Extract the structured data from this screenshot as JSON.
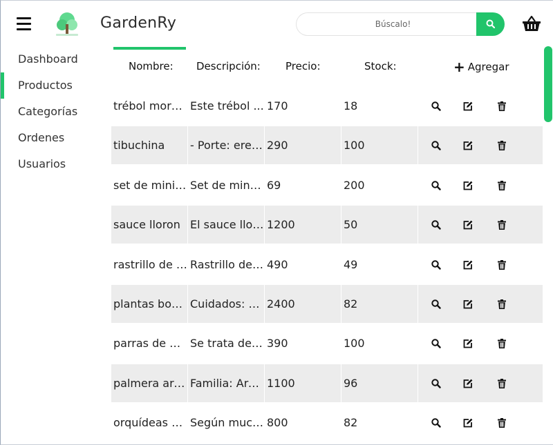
{
  "header": {
    "brand": "GardenRy",
    "search_placeholder": "Búscalo!"
  },
  "sidebar": {
    "items": [
      {
        "label": "Dashboard"
      },
      {
        "label": "Productos"
      },
      {
        "label": "Categorías"
      },
      {
        "label": "Ordenes"
      },
      {
        "label": "Usuarios"
      }
    ],
    "active_index": 1
  },
  "table": {
    "headers": {
      "name": "Nombre:",
      "description": "Descripción:",
      "price": "Precio:",
      "stock": "Stock:"
    },
    "add_label": "Agregar",
    "rows": [
      {
        "name": "trébol mora...",
        "description": "Este trébol ...",
        "price": "170",
        "stock": "18"
      },
      {
        "name": "tibuchina",
        "description": "- Porte: erec...",
        "price": "290",
        "stock": "100"
      },
      {
        "name": "set de mini ...",
        "description": "Set de mini ...",
        "price": "69",
        "stock": "200"
      },
      {
        "name": "sauce lloron",
        "description": "El sauce llor...",
        "price": "1200",
        "stock": "50"
      },
      {
        "name": "rastrillo de j...",
        "description": "Rastrillo de J...",
        "price": "490",
        "stock": "49"
      },
      {
        "name": "plantas bon...",
        "description": "Cuidados: Si...",
        "price": "2400",
        "stock": "82"
      },
      {
        "name": "parras de uva",
        "description": "Se trata de ...",
        "price": "390",
        "stock": "100"
      },
      {
        "name": "palmera are...",
        "description": "Familia: Are...",
        "price": "1100",
        "stock": "96"
      },
      {
        "name": "orquídeas p...",
        "description": "Según much...",
        "price": "800",
        "stock": "82"
      }
    ]
  },
  "colors": {
    "accent": "#21c46b",
    "row_shade": "#ececec"
  },
  "icons": {
    "menu": "hamburger-icon",
    "logo": "tree-icon",
    "search": "search-icon",
    "cart": "basket-icon",
    "add": "plus-icon",
    "view": "magnifier-icon",
    "edit": "edit-icon",
    "delete": "trash-icon"
  }
}
